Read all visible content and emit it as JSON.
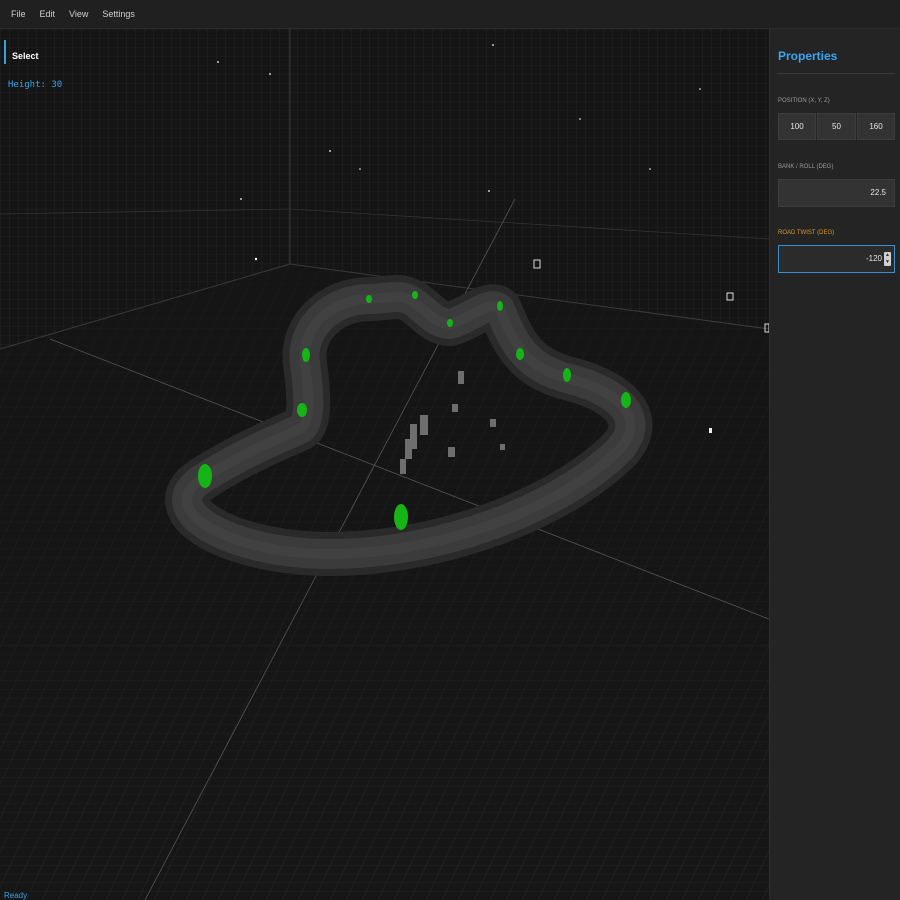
{
  "menu": {
    "items": [
      "File",
      "Edit",
      "View",
      "Settings"
    ]
  },
  "viewport": {
    "tool_label": "Select",
    "height_readout": "Height: 30",
    "status": "Ready"
  },
  "properties": {
    "title": "Properties",
    "position_label": "POSITION (X, Y, Z)",
    "position": {
      "x": "100",
      "y": "50",
      "z": "160"
    },
    "bank_label": "BANK / ROLL (DEG)",
    "bank_value": "22.5",
    "twist_label": "ROAD TWIST (DEG)",
    "twist_value": "-120"
  },
  "colors": {
    "accent": "#3aa6f0",
    "active_label": "#d89a32",
    "control_point": "#1fae1f",
    "track": "#3a3a3a"
  },
  "icons": {
    "spinner": "up-down-arrows-icon"
  }
}
